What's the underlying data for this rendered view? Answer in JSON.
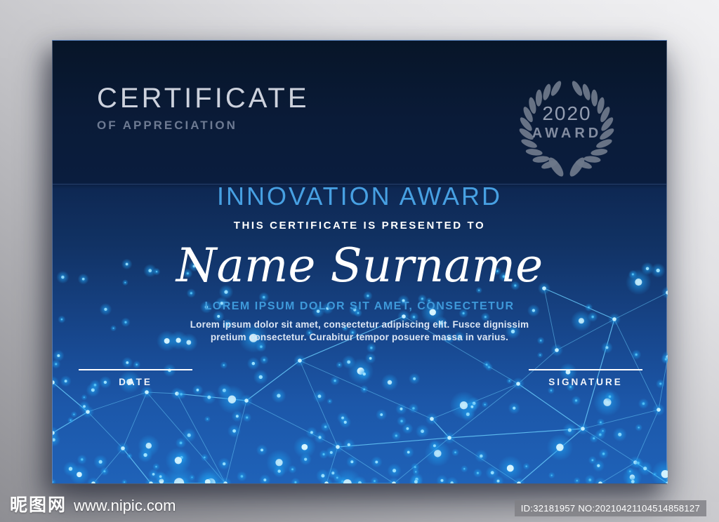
{
  "certificate": {
    "header": {
      "title": "CERTIFICATE",
      "subtitle": "OF APPRECIATION"
    },
    "badge": {
      "year": "2020",
      "label": "AWARD"
    },
    "award_title": "INNOVATION AWARD",
    "presented_line": "THIS CERTIFICATE IS PRESENTED TO",
    "recipient_name": "Name Surname",
    "tagline": "LOREM IPSUM DOLOR SIT AMET, CONSECTETUR",
    "description": [
      "Lorem ipsum dolor sit amet, consectetur adipiscing elit. Fusce dignissim",
      "pretium consectetur. Curabitur tempor posuere massa in varius."
    ],
    "fields": [
      {
        "label": "DATE"
      },
      {
        "label": "SIGNATURE"
      }
    ],
    "colors": {
      "card_navy": "#0a1b38",
      "card_blue": "#1f62b8",
      "accent_blue": "#47a0e2",
      "sparkle_cyan": "#35c1ff",
      "silver_text": "#cdd2dd",
      "laurel_gray": "#6d7789"
    }
  },
  "watermark": {
    "site_name": "昵图网",
    "site_url": "www.nipic.com",
    "id_text": "ID:32181957 NO:20210421104514858127"
  }
}
